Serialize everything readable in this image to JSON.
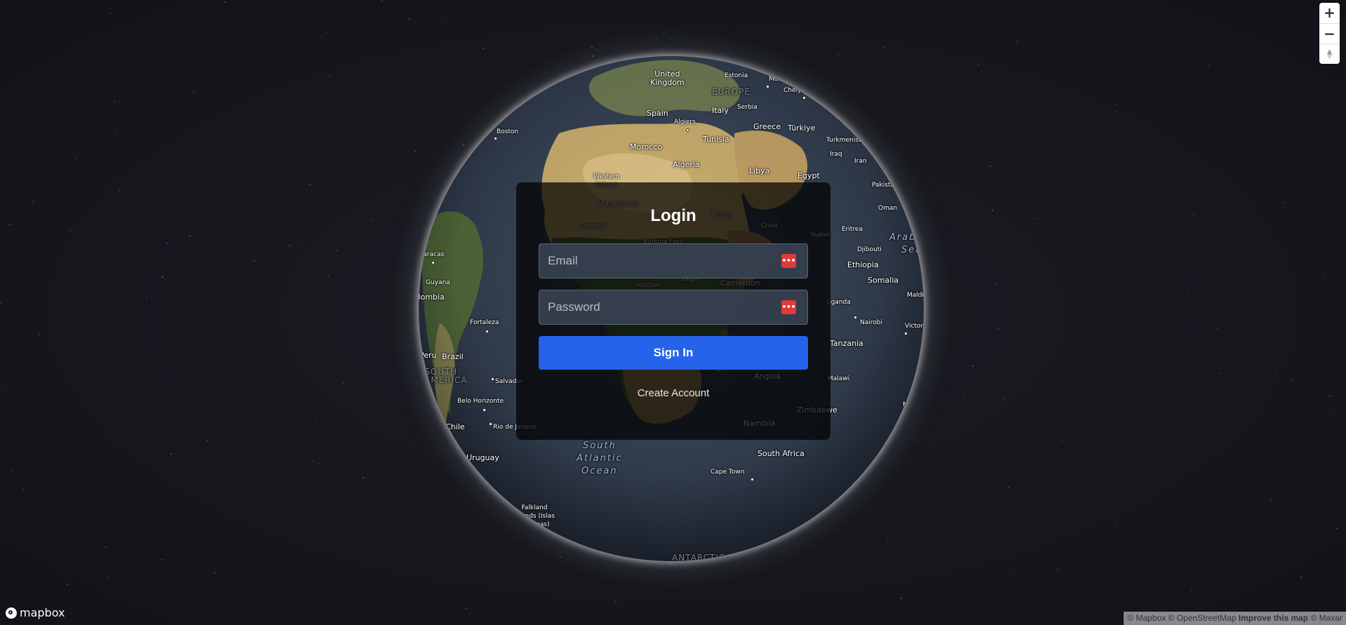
{
  "login": {
    "title": "Login",
    "email_placeholder": "Email",
    "password_placeholder": "Password",
    "signin_label": "Sign In",
    "create_account_label": "Create Account",
    "field_icon": "password-manager-icon"
  },
  "map_controls": {
    "zoom_in": "+",
    "zoom_out": "−",
    "compass": "compass-icon"
  },
  "branding": {
    "logo_text": "mapbox"
  },
  "attribution": {
    "mapbox": "© Mapbox",
    "osm": "© OpenStreetMap",
    "improve": "Improve this map",
    "maxar": "© Maxar"
  },
  "map_labels": {
    "united_kingdom": "United\nKingdom",
    "estonia": "Estonia",
    "moscow": "Moscow",
    "europe": "EUROPE",
    "serbia": "Serbia",
    "chelyabinsk": "Chelyabinsk",
    "spain": "Spain",
    "italy": "Italy",
    "algiers": "Algiers",
    "greece": "Greece",
    "turkiye": "Türkiye",
    "boston": "Boston",
    "tunisia": "Tunisia",
    "turkmenistan": "Turkmenistan",
    "morocco": "Morocco",
    "iraq": "Iraq",
    "algeria": "Algeria",
    "iran": "Iran",
    "libya": "Libya",
    "western_sahara": "Western\nSahara",
    "egypt": "Egypt",
    "pakistan": "Pakistan",
    "mauritania": "Mauritania",
    "niger": "Niger",
    "oman": "Oman",
    "senegal": "Senegal",
    "chad": "Chad",
    "sudan": "Sudan",
    "eritrea": "Eritrea",
    "arabian_sea": "Arabian\nSea",
    "burkina_faso": "Burkina Faso",
    "djibouti": "Djibouti",
    "caracas": "Caracas",
    "ethiopia": "Ethiopia",
    "lagos": "Lagos",
    "cameroon": "Cameroon",
    "guyana": "Guyana",
    "abidjan": "Abidjan",
    "somalia": "Somalia",
    "colombia": "Colombia",
    "maldives": "Maldives",
    "uganda": "Uganda",
    "nairobi": "Nairobi",
    "fortaleza": "Fortaleza",
    "victoria": "Victoria",
    "tanzania": "Tanzania",
    "peru": "Peru",
    "brazil": "Brazil",
    "south_america": "SOUTH\nAMERICA",
    "angola": "Angola",
    "malawi": "Malawi",
    "salvador": "Salvador",
    "belo_horizonte": "Belo Horizonte",
    "mauritius": "Mauritius",
    "zimbabwe": "Zimbabwe",
    "namibia": "Namibia",
    "chile": "Chile",
    "rio": "Rio de Janeiro",
    "south_atlantic": "South\nAtlantic\nOcean",
    "south_africa": "South Africa",
    "uruguay": "Uruguay",
    "cape_town": "Cape Town",
    "falkland": "Falkland\nIslands (Islas\nMalvinas)",
    "antarctica": "ANTARCTICA"
  }
}
